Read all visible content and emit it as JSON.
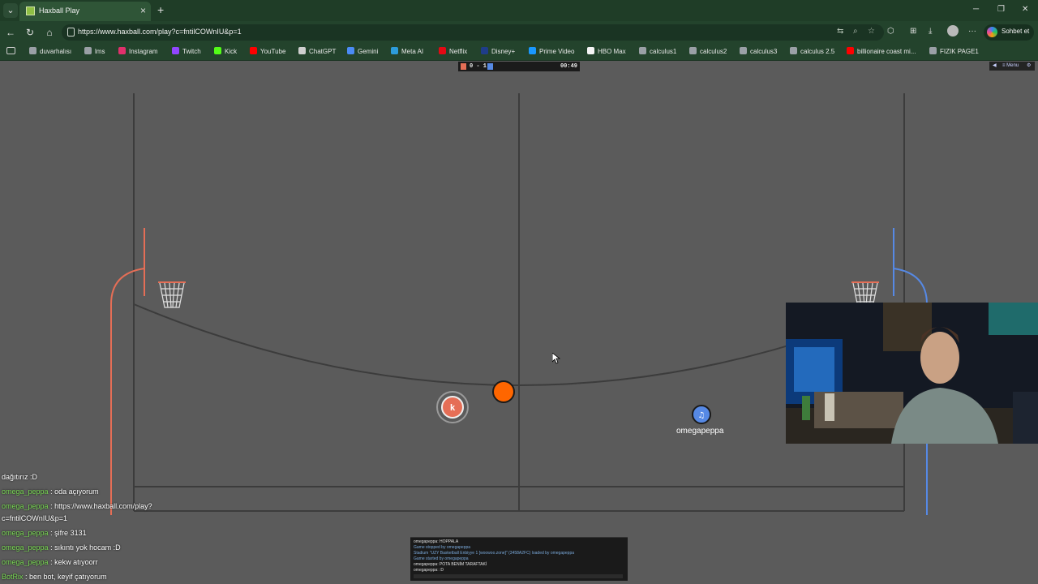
{
  "browser": {
    "tab_title": "Haxball Play",
    "url": "https://www.haxball.com/play?c=fntilCOWnIU&p=1",
    "copilot_label": "Sohbet et"
  },
  "bookmarks": [
    {
      "label": "duvarhalısı",
      "color": "#9aa0a6"
    },
    {
      "label": "lms",
      "color": "#9aa0a6"
    },
    {
      "label": "Instagram",
      "color": "#e1306c"
    },
    {
      "label": "Twitch",
      "color": "#9146ff"
    },
    {
      "label": "Kick",
      "color": "#53fc18"
    },
    {
      "label": "YouTube",
      "color": "#ff0000"
    },
    {
      "label": "ChatGPT",
      "color": "#cfcfcf"
    },
    {
      "label": "Gemini",
      "color": "#4b8bf5"
    },
    {
      "label": "Meta AI",
      "color": "#2d9cdb"
    },
    {
      "label": "Netflix",
      "color": "#e50914"
    },
    {
      "label": "Disney+",
      "color": "#1f3d8a"
    },
    {
      "label": "Prime Video",
      "color": "#1a98ff"
    },
    {
      "label": "HBO Max",
      "color": "#f5f5f5"
    },
    {
      "label": "calculus1",
      "color": "#9aa0a6"
    },
    {
      "label": "calculus2",
      "color": "#9aa0a6"
    },
    {
      "label": "calculus3",
      "color": "#9aa0a6"
    },
    {
      "label": "calculus 2.5",
      "color": "#9aa0a6"
    },
    {
      "label": "billionaire coast mi...",
      "color": "#ff0000"
    },
    {
      "label": "FIZIK PAGE1",
      "color": "#9aa0a6"
    }
  ],
  "scoreboard": {
    "score": "0 - 1",
    "time": "00:49",
    "red_color": "#e56e56",
    "blue_color": "#5689e5"
  },
  "game_menu": {
    "menu_label": "Menu"
  },
  "players": {
    "red_avatar": "k",
    "blue_avatar_icon": "music-note-icon",
    "blue_name": "omegapeppa"
  },
  "chat": [
    {
      "name": "",
      "text": "dağıtırız :D"
    },
    {
      "name": "omega_peppa",
      "text": " : oda açıyorum"
    },
    {
      "name": "omega_peppa",
      "text": " : https://www.haxball.com/play?"
    },
    {
      "name": "",
      "text": "c=fntilCOWnIU&p=1"
    },
    {
      "name": "omega_peppa",
      "text": " : şifre 3131"
    },
    {
      "name": "omega_peppa",
      "text": " : sıkıntı yok hocam :D"
    },
    {
      "name": "omega_peppa",
      "text": " : kekw atıyoorr"
    },
    {
      "name": "BotRix",
      "text": " : ben bot, keyif çatıyorum"
    }
  ],
  "console": [
    {
      "text": "omegapeppa: HOPPALA",
      "type": "msg"
    },
    {
      "text": "Game stopped by omegapeppa",
      "type": "sys"
    },
    {
      "text": "Stadium \"UZY Basketball Enbiyye 1 [woowoo.zone]\" (3458A2FC) loaded by omegapeppa",
      "type": "sys"
    },
    {
      "text": "Game started by omegapeppa",
      "type": "sys"
    },
    {
      "text": "omegapeppa: POTA BENİM TARAFTAKİ",
      "type": "msg"
    },
    {
      "text": "omegapeppa: :D",
      "type": "msg"
    }
  ]
}
